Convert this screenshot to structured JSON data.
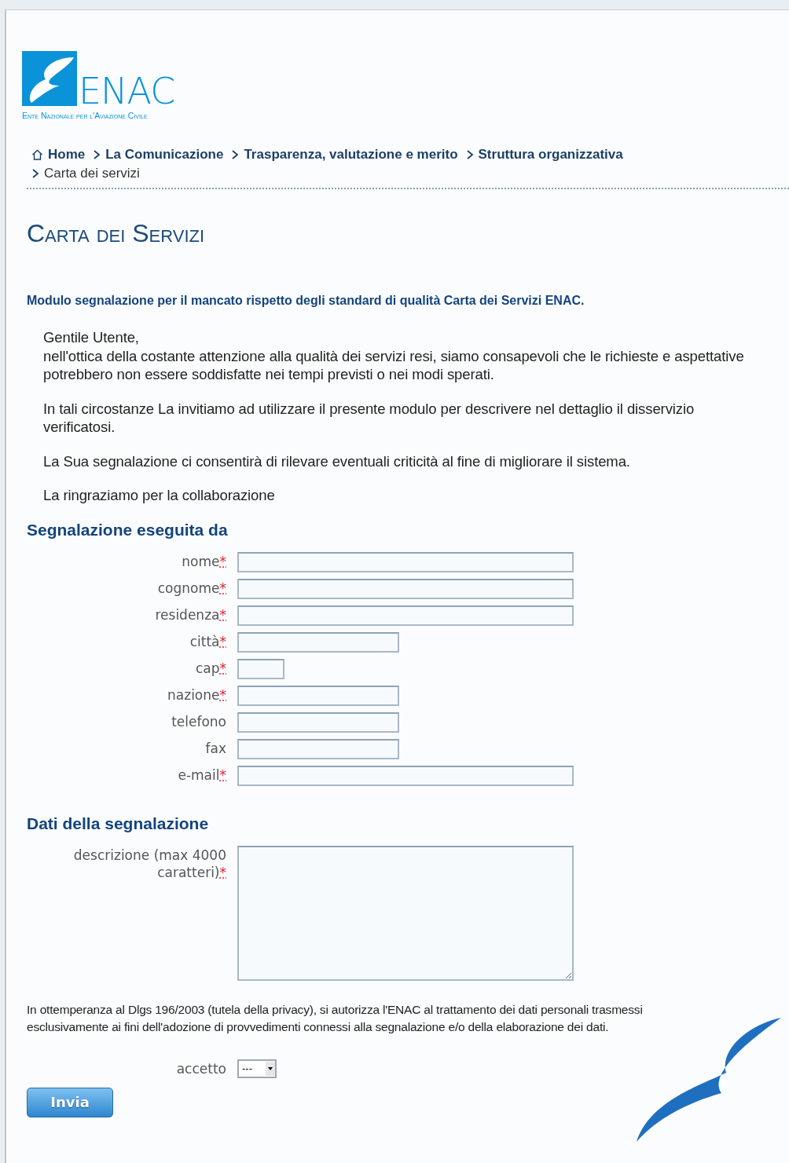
{
  "logo": {
    "wordmark": "ENAC",
    "tagline": "Ente Nazionale per l'Aviazione Civile"
  },
  "breadcrumb": [
    {
      "label": "Home",
      "kind": "home",
      "current": false
    },
    {
      "label": "La Comunicazione",
      "kind": "link",
      "current": false
    },
    {
      "label": "Trasparenza, valutazione e merito",
      "kind": "link",
      "current": false
    },
    {
      "label": "Struttura organizzativa",
      "kind": "link",
      "current": false
    },
    {
      "label": "Carta dei servizi",
      "kind": "link",
      "current": true
    }
  ],
  "page_title": "Carta dei Servizi",
  "form_heading": "Modulo segnalazione per il mancato rispetto degli standard di qualità Carta dei Servizi ENAC.",
  "intro": {
    "greeting": "Gentile Utente,",
    "paragraphs": [
      "nell'ottica della costante attenzione alla qualità dei servizi resi, siamo consapevoli che le richieste e aspettative potrebbero non essere soddisfatte nei tempi previsti o nei modi sperati.",
      "In tali circostanze La invitiamo ad utilizzare il presente modulo per descrivere nel dettaglio il disservizio verificatosi.",
      "La Sua segnalazione ci consentirà di rilevare eventuali criticità al fine di migliorare il sistema.",
      "La ringraziamo per la collaborazione"
    ]
  },
  "sections": [
    {
      "title": "Segnalazione eseguita da",
      "fields": [
        {
          "label": "nome",
          "required_mark": "*",
          "kind": "wide"
        },
        {
          "label": "cognome",
          "required_mark": "*",
          "kind": "wide"
        },
        {
          "label": "residenza",
          "required_mark": "*",
          "kind": "wide"
        },
        {
          "label": "città",
          "required_mark": "*",
          "kind": "medium"
        },
        {
          "label": "cap",
          "required_mark": "*",
          "kind": "short"
        },
        {
          "label": "nazione",
          "required_mark": "*",
          "kind": "medium"
        },
        {
          "label": "telefono",
          "kind": "medium"
        },
        {
          "label": "fax",
          "kind": "medium"
        },
        {
          "label": "e-mail",
          "required_mark": "*",
          "kind": "wide"
        }
      ]
    },
    {
      "title": "Dati della segnalazione",
      "fields": [
        {
          "label": "descrizione (max 4000 caratteri)",
          "required_mark": "*",
          "kind": "textarea"
        }
      ]
    }
  ],
  "privacy_notice": "In ottemperanza al Dlgs 196/2003 (tutela della privacy), si autorizza l'ENAC al trattamento dei dati personali trasmessi esclusivamente ai fini dell'adozione di provvedimenti connessi alla segnalazione e/o della elaborazione dei dati.",
  "consent": {
    "label": "accetto",
    "value": "---"
  },
  "submit": "Invia"
}
